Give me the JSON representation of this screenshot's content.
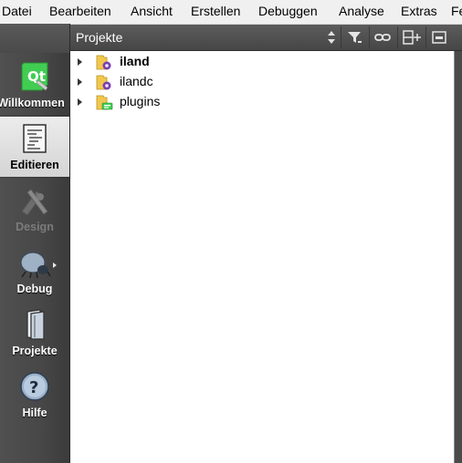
{
  "menubar": {
    "items": [
      "Datei",
      "Bearbeiten",
      "Ansicht",
      "Erstellen",
      "Debuggen",
      "Analyse",
      "Extras",
      "Fe"
    ]
  },
  "modebar": {
    "modes": [
      {
        "label": "Willkommen",
        "icon": "qt-logo-icon",
        "state": "normal"
      },
      {
        "label": "Editieren",
        "icon": "document-edit-icon",
        "state": "active"
      },
      {
        "label": "Design",
        "icon": "design-pencil-icon",
        "state": "disabled"
      },
      {
        "label": "Debug",
        "icon": "bug-icon",
        "state": "normal"
      },
      {
        "label": "Projekte",
        "icon": "projects-folder-icon",
        "state": "normal"
      },
      {
        "label": "Hilfe",
        "icon": "help-icon",
        "state": "normal"
      }
    ]
  },
  "projects_pane": {
    "title": "Projekte",
    "tools": [
      "filter-icon",
      "link-icon",
      "split-icon",
      "close-pane-icon"
    ],
    "tree": [
      {
        "label": "iland",
        "bold": true,
        "icon": "project-folder-icon"
      },
      {
        "label": "ilandc",
        "bold": false,
        "icon": "project-folder-icon"
      },
      {
        "label": "plugins",
        "bold": false,
        "icon": "subdirs-folder-icon"
      }
    ]
  },
  "colors": {
    "modebar_bg": "#474747",
    "active_mode_bg": "#e0e0e0",
    "menubar_bg": "#f0f0f0",
    "qt_green": "#41cd52",
    "folder_yellow": "#f2c84b"
  }
}
